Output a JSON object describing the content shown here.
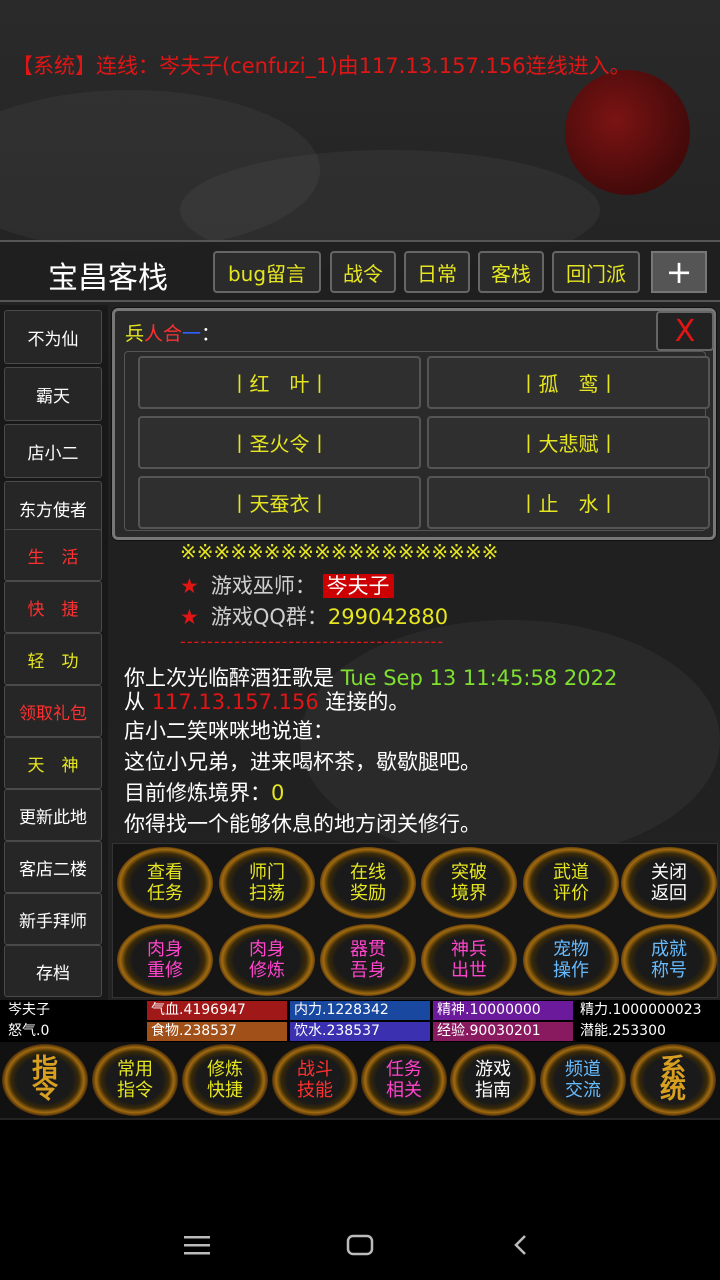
{
  "system_message": "【系统】连线：岑夫子(cenfuzi_1)由117.13.157.156连线进入。",
  "header": {
    "location": "宝昌客栈",
    "buttons": [
      "bug留言",
      "战令",
      "日常",
      "客栈",
      "回门派"
    ],
    "plus": "+"
  },
  "sidebar": [
    "不为仙",
    "霸天",
    "店小二",
    "东方使者",
    "生　活",
    "快　捷",
    "轻　功",
    "领取礼包",
    "天　神",
    "更新此地",
    "客店二楼",
    "新手拜师",
    "存档"
  ],
  "sidebar_colors": [
    "#ffffff",
    "#ffffff",
    "#ffffff",
    "#ffffff",
    "#ff3030",
    "#ff3030",
    "#e6e620",
    "#ff3030",
    "#e6e620",
    "#ffffff",
    "#ffffff",
    "#ffffff",
    "#ffffff"
  ],
  "popup": {
    "title_parts": [
      "兵",
      "人",
      "合",
      "一",
      "："
    ],
    "close": "X",
    "items": [
      "丨红　叶丨",
      "丨孤　鸾丨",
      "丨圣火令丨",
      "丨大悲赋丨",
      "丨天蚕衣丨",
      "丨止　水丨"
    ]
  },
  "info": {
    "stars": "※※※※※※※※※※※※※※※※※※※",
    "star_icon": "★",
    "wizard_label": "游戏巫师：",
    "wizard_name": "岑夫子",
    "qq_label": "游戏QQ群：",
    "qq_value": "299042880",
    "dashes": "---------------------------------------"
  },
  "messages": {
    "last_visit_prefix": "你上次光临醉酒狂歌是",
    "last_visit_time": "Tue Sep 13 11:45:58 2022",
    "from": "从",
    "ip": "117.13.157.156",
    "connected": "连接的。",
    "line3": "店小二笑咪咪地说道：",
    "line4": "这位小兄弟，进来喝杯茶，歇歇腿吧。",
    "cultivation_label": "目前修炼境界：",
    "cultivation_value": "0",
    "line6": "你得找一个能够休息的地方闭关修行。"
  },
  "grid": [
    {
      "l1": "查看",
      "l2": "任务",
      "color": "yellow"
    },
    {
      "l1": "师门",
      "l2": "扫荡",
      "color": "yellow"
    },
    {
      "l1": "在线",
      "l2": "奖励",
      "color": "yellow"
    },
    {
      "l1": "突破",
      "l2": "境界",
      "color": "yellow"
    },
    {
      "l1": "武道",
      "l2": "评价",
      "color": "yellow"
    },
    {
      "l1": "关闭",
      "l2": "返回",
      "color": "white"
    },
    {
      "l1": "肉身",
      "l2": "重修",
      "color": "pink"
    },
    {
      "l1": "肉身",
      "l2": "修炼",
      "color": "pink"
    },
    {
      "l1": "器贯",
      "l2": "吾身",
      "color": "pink"
    },
    {
      "l1": "神兵",
      "l2": "出世",
      "color": "pink"
    },
    {
      "l1": "宠物",
      "l2": "操作",
      "color": "blue"
    },
    {
      "l1": "成就",
      "l2": "称号",
      "color": "blue"
    }
  ],
  "status": {
    "name": "岑夫子",
    "qixue": "气血.4196947",
    "neili": "内力.1228342",
    "jingshen": "精神.10000000",
    "jingli": "精力.1000000023",
    "nuqi": "怒气.0",
    "shiwu": "食物.238537",
    "yinshui": "饮水.238537",
    "jingyan": "经验.90030201",
    "qianneng": "潜能.253300"
  },
  "status_colors": {
    "qixue": "#a01818",
    "neili": "#1848a0",
    "jingshen": "#6a1a9a",
    "shiwu": "#a05018",
    "yinshui": "#3a30b0",
    "jingyan": "#8a1a60"
  },
  "bottom_nav": [
    {
      "l1": "指",
      "l2": "令",
      "color": "#d9a020",
      "style": "gold"
    },
    {
      "l1": "常用",
      "l2": "指令",
      "color": "#e6e620"
    },
    {
      "l1": "修炼",
      "l2": "快捷",
      "color": "#e6e620"
    },
    {
      "l1": "战斗",
      "l2": "技能",
      "color": "#ff3030"
    },
    {
      "l1": "任务",
      "l2": "相关",
      "color": "#ff44cc"
    },
    {
      "l1": "游戏",
      "l2": "指南",
      "color": "#ffffff"
    },
    {
      "l1": "频道",
      "l2": "交流",
      "color": "#66bbff"
    },
    {
      "l1": "系",
      "l2": "统",
      "color": "#d9a020",
      "style": "gold"
    }
  ]
}
